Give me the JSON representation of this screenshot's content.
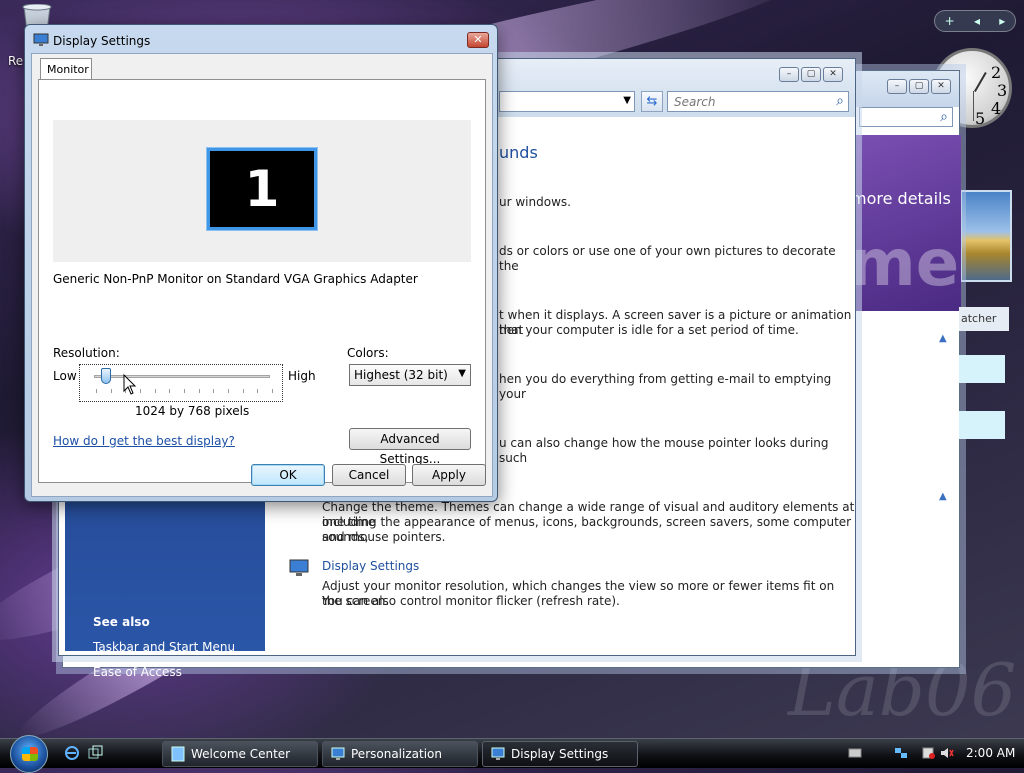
{
  "desktop": {
    "recycle_label": "Re",
    "watermark": "Lab06",
    "gadget_bar": {
      "add_label": "+",
      "prev_label": "◂",
      "next_label": "▸"
    },
    "clock_numerals": [
      "2",
      "3",
      "4",
      "5"
    ]
  },
  "welcome_window": {
    "more_details": "more details",
    "big_text": "me",
    "side_label": "atcher"
  },
  "personalization_window": {
    "search_placeholder": "Search",
    "title_fragment": "unds",
    "line_1": "ur windows.",
    "line_2": "ds or colors or use one of your own pictures to decorate the",
    "line_3a": "t when it displays. A screen saver is a picture or animation that",
    "line_3b": "hen your computer is idle for a set period of time.",
    "line_4": "hen you do everything from getting e-mail to emptying your",
    "line_5": "u can also change how the mouse pointer looks during such",
    "theme_text_1": "Change the theme. Themes can change a wide range of visual and auditory elements at one time",
    "theme_text_2": "including the appearance of menus, icons, backgrounds, screen savers, some computer sounds,",
    "theme_text_3": "and mouse pointers.",
    "display_settings_link": "Display Settings",
    "display_desc_1": "Adjust your monitor resolution, which changes the view so more or fewer items fit on the screen.",
    "display_desc_2": "You can also control monitor flicker (refresh rate).",
    "see_also": "See also",
    "see_also_links": [
      "Taskbar and Start Menu",
      "Ease of Access"
    ]
  },
  "dialog": {
    "title": "Display Settings",
    "close_label": "✕",
    "tab_label": "Monitor",
    "monitor_number": "1",
    "monitor_name": "Generic Non-PnP Monitor on Standard VGA Graphics Adapter",
    "resolution_label": "Resolution:",
    "low_label": "Low",
    "high_label": "High",
    "resolution_value": "1024 by 768 pixels",
    "resolution_slider_fraction": 0.05,
    "colors_label": "Colors:",
    "colors_value": "Highest (32 bit)",
    "help_link": "How do I get the best display?",
    "advanced_button": "Advanced Settings...",
    "ok_button": "OK",
    "cancel_button": "Cancel",
    "apply_button": "Apply"
  },
  "taskbar": {
    "tasks": [
      {
        "label": "Welcome Center"
      },
      {
        "label": "Personalization"
      },
      {
        "label": "Display Settings"
      }
    ],
    "time": "2:00 AM"
  }
}
